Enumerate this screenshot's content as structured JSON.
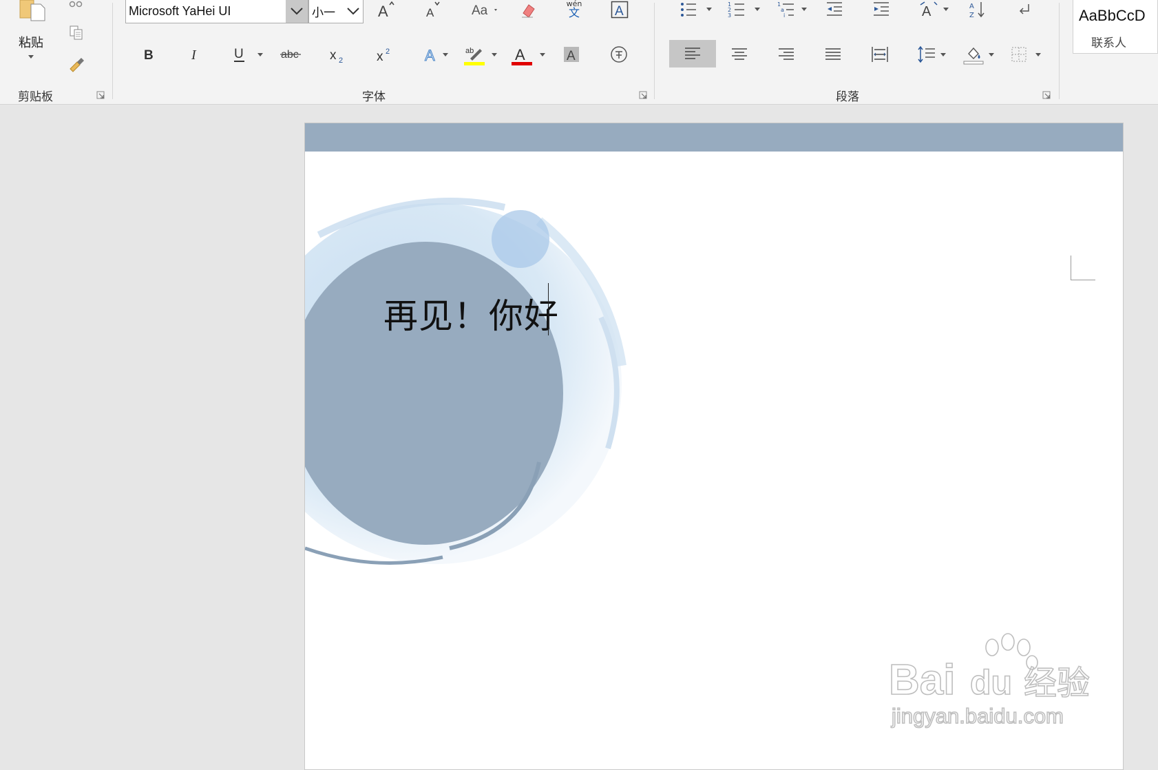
{
  "ribbon": {
    "clipboard": {
      "paste_label": "粘贴",
      "group_label": "剪贴板"
    },
    "font": {
      "font_name": "Microsoft YaHei UI",
      "font_size": "小一",
      "group_label": "字体",
      "phonetic_small": "wén",
      "phonetic_big": "文"
    },
    "paragraph": {
      "group_label": "段落"
    },
    "styles": {
      "preview_text": "AaBbCcD",
      "style_name": "联系人"
    }
  },
  "document": {
    "text": "再见！你好"
  },
  "watermark": {
    "brand_latin": "Bai",
    "brand_du": "du",
    "brand_cn": "经验",
    "url": "jingyan.baidu.com"
  },
  "colors": {
    "accent_band": "#97abbf",
    "highlight": "#ffff00",
    "font_color": "#e00000",
    "circle_dark": "#97abbf",
    "circle_light": "#d6e6f4"
  }
}
